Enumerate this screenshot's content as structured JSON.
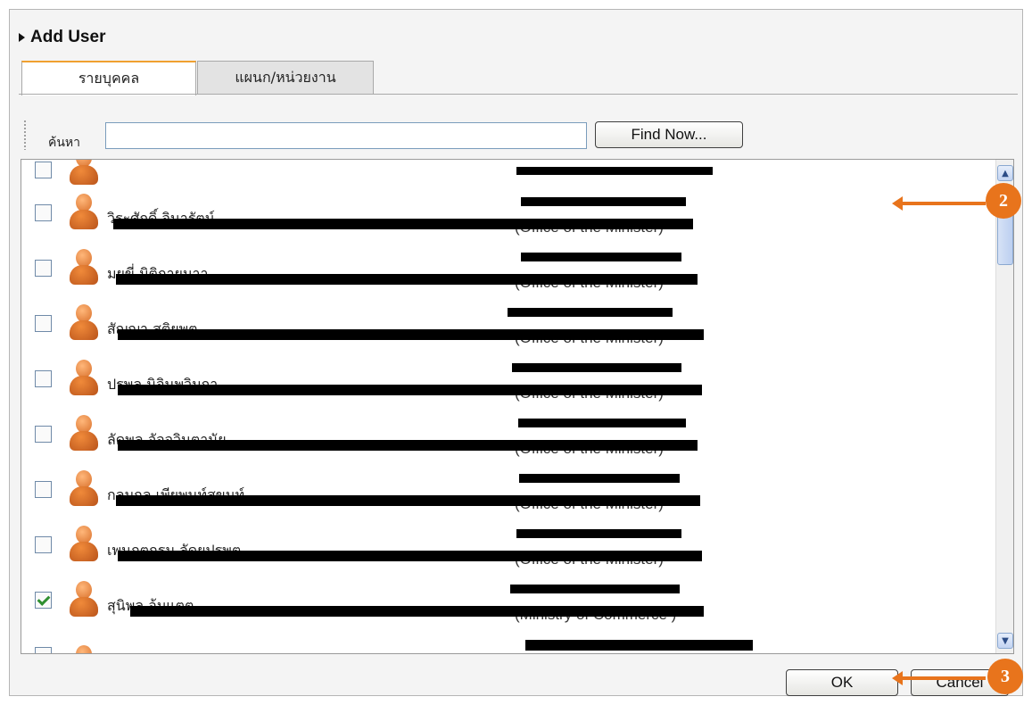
{
  "header": {
    "title": "Add User"
  },
  "tabs": [
    {
      "label": "รายบุคคล",
      "active": true
    },
    {
      "label": "แผนก/หน่วยงาน",
      "active": false
    }
  ],
  "search": {
    "label": "ค้นหา",
    "value": "",
    "find_button": "Find Now..."
  },
  "list": {
    "rows": [
      {
        "name": "วิระศักดิ์ จินารัตน์",
        "dept_en": "(Office of the Minister)",
        "checked": false
      },
      {
        "name": "มยุขี่ มิติกายมาา",
        "dept_en": "(Office of the Minister)",
        "checked": false
      },
      {
        "name": "สัญญา สติยพุต",
        "dept_en": "(Office of the Minister)",
        "checked": false
      },
      {
        "name": "ปรพล นิจินพวิมกา",
        "dept_en": "(Office of the Minister)",
        "checked": false
      },
      {
        "name": "ลัดพล อัจจวินตานัย",
        "dept_en": "(Office of the Minister)",
        "checked": false
      },
      {
        "name": "กลมกล เพียพนท์สุขนท์",
        "dept_en": "(Office of the Minister)",
        "checked": false
      },
      {
        "name": "เพนุกตกรม ลัดยปรพุต",
        "dept_en": "(Office of the Minister)",
        "checked": false
      },
      {
        "name": "สุนิพล อ้มแตต",
        "dept_en": "(Ministry of Commerce )",
        "checked": true
      }
    ]
  },
  "footer": {
    "ok_label": "OK",
    "cancel_label": "Cancel"
  },
  "callouts": {
    "scroll_hint": "2",
    "ok_hint": "3"
  },
  "colors": {
    "accent": "#e8741c",
    "tab_accent": "#f0a030",
    "check": "#2f8f2f"
  }
}
